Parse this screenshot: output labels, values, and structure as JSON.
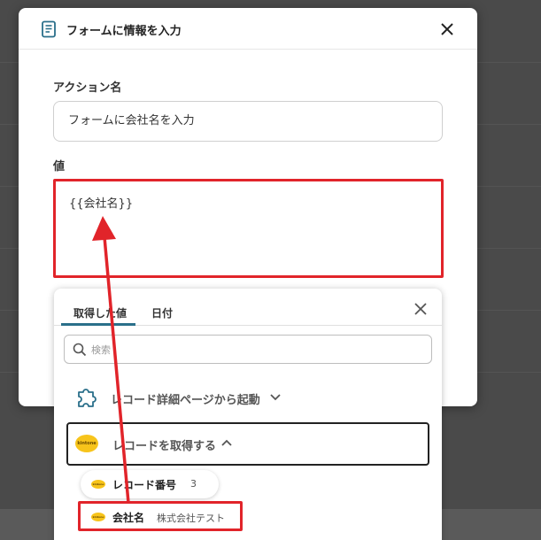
{
  "modal": {
    "title": "フォームに情報を入力"
  },
  "action_name": {
    "label": "アクション名",
    "value": "フォームに会社名を入力"
  },
  "value_field": {
    "label": "値",
    "value": "{{会社名}}"
  },
  "picker": {
    "tabs": [
      {
        "label": "取得した値",
        "active": true
      },
      {
        "label": "日付",
        "active": false
      }
    ],
    "search_placeholder": "検索",
    "groups": [
      {
        "label": "レコード詳細ページから起動",
        "icon": "puzzle-icon",
        "expanded": false
      },
      {
        "label": "レコードを取得する",
        "icon": "kintone-logo",
        "expanded": true
      }
    ],
    "items": [
      {
        "name": "レコード番号",
        "value": "3"
      },
      {
        "name": "会社名",
        "value": "株式会社テスト"
      }
    ],
    "logo_text": "kintone"
  },
  "colors": {
    "highlight": "#e1242a",
    "tab_accent": "#2a6f8a",
    "kintone_yellow": "#f7c41b"
  }
}
